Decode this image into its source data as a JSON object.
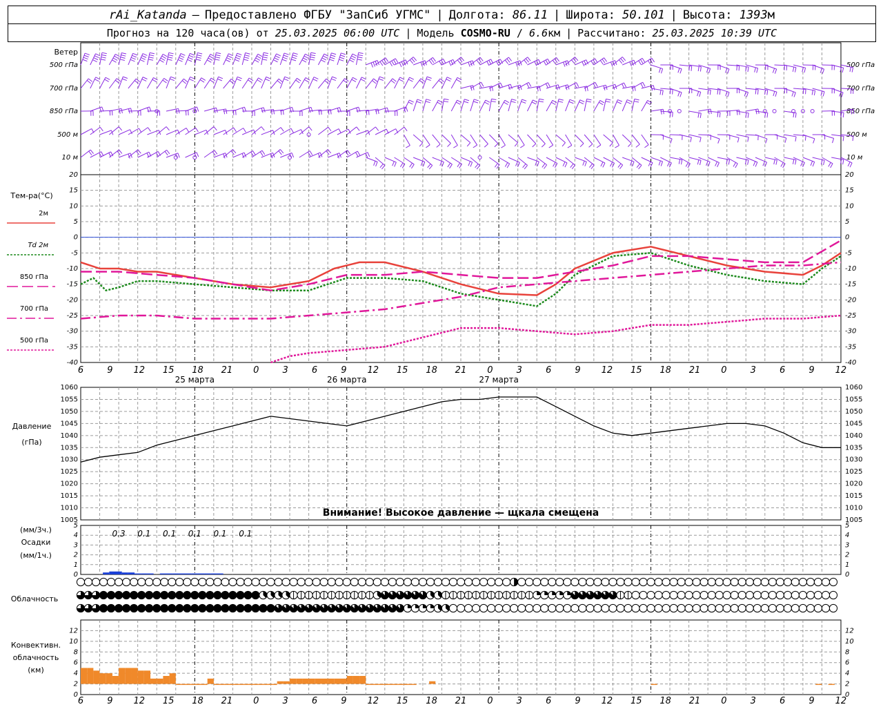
{
  "header": {
    "station": "rAi_Katanda",
    "dash": "—",
    "provided": "Предоставлено ФГБУ \"ЗапСиб УГМС\"",
    "lon_label": "Долгота:",
    "lon": "86.11",
    "lat_label": "Широта:",
    "lat": "50.101",
    "alt_label": "Высота:",
    "alt": "1393",
    "alt_unit": "м",
    "forecast_label": "Прогноз на 120 часа(ов) от",
    "forecast_time": "25.03.2025 06:00 UTC",
    "model_label": "Модель",
    "model": "COSMO-RU",
    "model_res": "6.6",
    "model_unit": "км",
    "calc_label": "Рассчитано:",
    "calc_time": "25.03.2025 10:39 UTC"
  },
  "colors": {
    "t2m": "#e8423b",
    "td2m": "#1c8a1c",
    "t850": "#e0179a",
    "t700": "#e0179a",
    "t500": "#e0179a",
    "wind": "#8a2be2",
    "pressure": "#000000",
    "precip": "#1a3fd6",
    "conv": "#f0892a",
    "zero": "#3050d8",
    "grid": "#9a9a9a"
  },
  "chart_data": [
    {
      "type": "wind-barbs",
      "title": "Ветер",
      "levels": [
        "500 гПа",
        "700 гПа",
        "850 гПа",
        "500 м",
        "10  м"
      ],
      "calm_hours": {
        "850 гПа": [
          12,
          18,
          93,
          94,
          108,
          110,
          112,
          114,
          116
        ],
        "500 м": [
          36
        ],
        "10  м": [
          15,
          18,
          33,
          63
        ]
      }
    },
    {
      "type": "line",
      "ylabel": "Тем-ра(°C)",
      "ylim": [
        -40,
        20
      ],
      "yticks": [
        20,
        15,
        10,
        5,
        0,
        -5,
        -10,
        -15,
        -20,
        -25,
        -30,
        -35,
        -40
      ],
      "legend": [
        "2м",
        "Td  2м",
        "850 гПа",
        "700 гПа",
        "500 гПа"
      ],
      "series": [
        {
          "name": "2м",
          "x": [
            0,
            3,
            6,
            9,
            12,
            18,
            24,
            30,
            36,
            40,
            44,
            48,
            54,
            60,
            66,
            72,
            75,
            78,
            84,
            90,
            96,
            102,
            108,
            114,
            117,
            120
          ],
          "values": [
            -8,
            -10,
            -10,
            -11,
            -11,
            -13,
            -15,
            -16,
            -14,
            -10,
            -8,
            -8,
            -11,
            -15,
            -18,
            -18.5,
            -15,
            -10,
            -5,
            -3,
            -6,
            -9,
            -11,
            -12,
            -9,
            -5
          ]
        },
        {
          "name": "Td  2м",
          "x": [
            0,
            2,
            4,
            6,
            9,
            12,
            18,
            24,
            30,
            36,
            42,
            48,
            54,
            60,
            66,
            72,
            75,
            78,
            84,
            90,
            96,
            102,
            108,
            114,
            117,
            120
          ],
          "values": [
            -15,
            -13,
            -17,
            -16,
            -14,
            -14,
            -15,
            -16,
            -17,
            -17,
            -13,
            -13,
            -14,
            -18,
            -20,
            -22,
            -18,
            -12,
            -6,
            -5,
            -9,
            -12,
            -14,
            -15,
            -10,
            -6
          ]
        },
        {
          "name": "850 гПа",
          "x": [
            0,
            6,
            12,
            18,
            24,
            30,
            36,
            42,
            48,
            54,
            60,
            66,
            72,
            78,
            84,
            90,
            96,
            102,
            108,
            114,
            120
          ],
          "values": [
            -11,
            -11,
            -12,
            -13,
            -15,
            -17,
            -15,
            -12,
            -12,
            -11,
            -12,
            -13,
            -13,
            -11,
            -9,
            -6,
            -6,
            -7,
            -8,
            -8,
            -1
          ]
        },
        {
          "name": "700 гПа",
          "x": [
            0,
            6,
            12,
            18,
            24,
            30,
            36,
            42,
            48,
            54,
            60,
            66,
            72,
            78,
            84,
            90,
            96,
            102,
            108,
            114,
            120
          ],
          "values": [
            -26,
            -25,
            -25,
            -26,
            -26,
            -26,
            -25,
            -24,
            -23,
            -21,
            -19,
            -16,
            -15,
            -14,
            -13,
            -12,
            -11,
            -10,
            -9,
            -9,
            -8
          ]
        },
        {
          "name": "500 гПа",
          "x": [
            30,
            33,
            36,
            42,
            48,
            54,
            60,
            66,
            72,
            78,
            84,
            90,
            96,
            102,
            108,
            114,
            120
          ],
          "values": [
            -40,
            -38,
            -37,
            -36,
            -35,
            -32,
            -29,
            -29,
            -30,
            -31,
            -30,
            -28,
            -28,
            -27,
            -26,
            -26,
            -25
          ]
        }
      ]
    },
    {
      "type": "line",
      "ylabel": "Давление",
      "ylabel_unit": "(гПа)",
      "ylim": [
        1005,
        1060
      ],
      "yticks": [
        1060,
        1055,
        1050,
        1045,
        1040,
        1035,
        1030,
        1025,
        1020,
        1015,
        1010,
        1005
      ],
      "annotation": "Внимание! Высокое давление — щкала смещена",
      "series": [
        {
          "name": "pressure",
          "x": [
            0,
            3,
            6,
            9,
            12,
            15,
            18,
            21,
            24,
            27,
            30,
            33,
            36,
            39,
            42,
            45,
            48,
            51,
            54,
            57,
            60,
            63,
            66,
            69,
            72,
            75,
            78,
            81,
            84,
            87,
            90,
            93,
            96,
            99,
            102,
            105,
            108,
            111,
            114,
            117,
            120
          ],
          "values": [
            1029,
            1031,
            1032,
            1033,
            1036,
            1038,
            1040,
            1042,
            1044,
            1046,
            1048,
            1047,
            1046,
            1045,
            1044,
            1046,
            1048,
            1050,
            1052,
            1054,
            1055,
            1055,
            1056,
            1056,
            1056,
            1052,
            1048,
            1044,
            1041,
            1040,
            1041,
            1042,
            1043,
            1044,
            1045,
            1045,
            1044,
            1041,
            1037,
            1035,
            1035
          ]
        }
      ]
    },
    {
      "type": "bar",
      "ylabel": "Осадки",
      "ylabel_top": "(мм/3ч.)",
      "ylabel_bottom": "(мм/1ч.)",
      "ylim": [
        0,
        5
      ],
      "yticks": [
        5,
        4,
        3,
        2,
        1,
        0
      ],
      "labels_3h": [
        {
          "x": 6,
          "text": "0.3"
        },
        {
          "x": 9,
          "text": "0.1"
        },
        {
          "x": 12,
          "text": "0.1"
        },
        {
          "x": 15,
          "text": "0.1"
        },
        {
          "x": 18,
          "text": "0.1"
        },
        {
          "x": 21,
          "text": "0.1"
        }
      ],
      "hourly": {
        "x": [
          4,
          5,
          6,
          7,
          8,
          9,
          10,
          11,
          13,
          14,
          15,
          16,
          17,
          18,
          19,
          20,
          21,
          22
        ],
        "values": [
          0.2,
          0.3,
          0.3,
          0.2,
          0.2,
          0.1,
          0.1,
          0.1,
          0.1,
          0.1,
          0.1,
          0.1,
          0.1,
          0.1,
          0.1,
          0.1,
          0.1,
          0.1
        ]
      }
    },
    {
      "type": "table",
      "title": "Облачность",
      "rows": 3,
      "note": "cloud cover octas per hour, 0-8"
    },
    {
      "type": "bar",
      "ylabel_lines": [
        "Конвективн.",
        "облачность",
        "(км)"
      ],
      "ylim": [
        0,
        14
      ],
      "yticks": [
        12,
        10,
        8,
        6,
        4,
        2,
        0
      ],
      "x": [
        0,
        1,
        2,
        3,
        4,
        5,
        6,
        7,
        8,
        9,
        10,
        11,
        12,
        13,
        14,
        15,
        16,
        17,
        18,
        19,
        20,
        21,
        22,
        23,
        24,
        25,
        26,
        27,
        28,
        29,
        30,
        31,
        32,
        33,
        34,
        35,
        36,
        37,
        38,
        39,
        40,
        41,
        42,
        43,
        44,
        45,
        46,
        47,
        48,
        49,
        50,
        51,
        52,
        55,
        90,
        116,
        118
      ],
      "bottom": [
        2,
        2,
        2,
        2,
        2,
        2,
        2,
        2,
        2,
        2,
        2,
        2,
        2,
        2,
        2,
        2,
        2,
        2,
        2,
        2,
        2,
        2,
        2,
        2,
        2,
        2,
        2,
        2,
        2,
        2,
        2,
        2,
        2,
        2,
        2,
        2,
        2,
        2,
        2,
        2,
        2,
        2,
        2,
        2,
        2,
        2,
        2,
        2,
        2,
        2,
        2,
        2,
        2,
        2,
        2,
        2,
        2
      ],
      "top": [
        5,
        5,
        4.5,
        4,
        4,
        3.5,
        5,
        5,
        5,
        4.5,
        4.5,
        3,
        3,
        3.5,
        4,
        2,
        2,
        2,
        2,
        2,
        3,
        2,
        2,
        2,
        2,
        2,
        2,
        2,
        2,
        2,
        2,
        2.5,
        2.5,
        3,
        3,
        3,
        3,
        3,
        3,
        3,
        3,
        3,
        3.5,
        3.5,
        3.5,
        2,
        2,
        2,
        2,
        2,
        2,
        2,
        2,
        2.5,
        2,
        2,
        2
      ]
    }
  ],
  "axis": {
    "hour_labels": [
      "6",
      "9",
      "12",
      "15",
      "18",
      "21",
      "0",
      "3",
      "6",
      "9",
      "12",
      "15",
      "18",
      "21",
      "0",
      "3",
      "6",
      "9",
      "12",
      "15",
      "18",
      "21",
      "0",
      "3",
      "6",
      "9",
      "12"
    ],
    "day_labels": [
      {
        "text": "25 марта",
        "hour": 18
      },
      {
        "text": "26 марта",
        "hour": 42
      },
      {
        "text": "27 марта",
        "hour": 66
      }
    ]
  }
}
